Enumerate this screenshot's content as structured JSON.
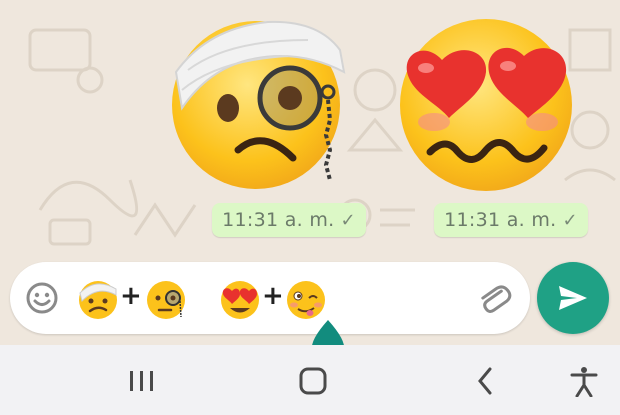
{
  "messages": [
    {
      "sticker": "bandage-monocle-sticker",
      "time": "11:31 a. m.",
      "status": "✓"
    },
    {
      "sticker": "heart-eyes-woozy-sticker",
      "time": "11:31 a. m.",
      "status": "✓"
    }
  ],
  "input": {
    "plus_sign": "+",
    "first_combo": [
      "head-bandage-emoji",
      "monocle-emoji"
    ],
    "second_combo": [
      "heart-eyes-emoji",
      "woozy-emoji"
    ]
  },
  "colors": {
    "send_button": "#1fa185",
    "bubble": "#dcf8c6",
    "wallpaper": "#efe7dd"
  },
  "nav": [
    "recent-apps-icon",
    "home-icon",
    "back-icon",
    "accessibility-icon"
  ]
}
